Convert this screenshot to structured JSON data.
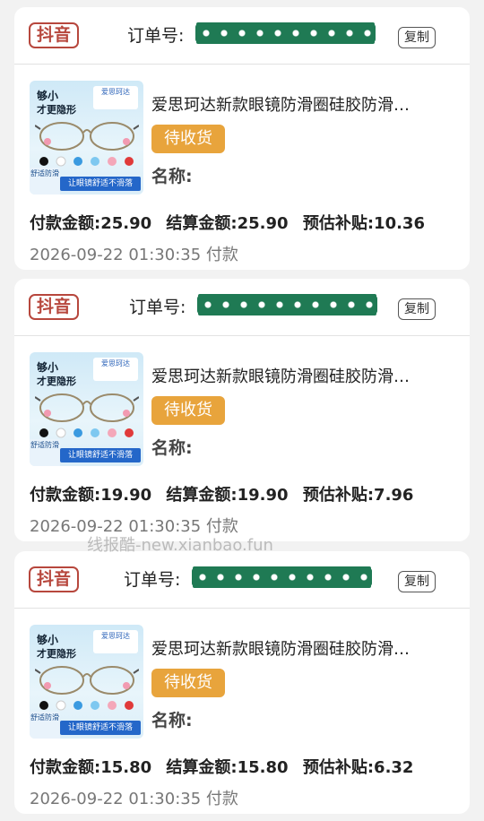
{
  "orders": [
    {
      "platform": "抖音",
      "order_label": "订单号:",
      "copy_label": "复制",
      "product_title": "爱思珂达新款眼镜防滑圈硅胶防滑…",
      "status": "待收货",
      "name_label": "名称:",
      "pay_amount": "付款金额:25.90",
      "settle_amount": "结算金额:25.90",
      "subsidy": "预估补贴:10.36",
      "paid_time": "2026-09-22 01:30:35 付款"
    },
    {
      "platform": "抖音",
      "order_label": "订单号:",
      "copy_label": "复制",
      "product_title": "爱思珂达新款眼镜防滑圈硅胶防滑…",
      "status": "待收货",
      "name_label": "名称:",
      "pay_amount": "付款金额:19.90",
      "settle_amount": "结算金额:19.90",
      "subsidy": "预估补贴:7.96",
      "paid_time": "2026-09-22 01:30:35 付款"
    },
    {
      "platform": "抖音",
      "order_label": "订单号:",
      "copy_label": "复制",
      "product_title": "爱思珂达新款眼镜防滑圈硅胶防滑…",
      "status": "待收货",
      "name_label": "名称:",
      "pay_amount": "付款金额:15.80",
      "settle_amount": "结算金额:15.80",
      "subsidy": "预估补贴:6.32",
      "paid_time": "2026-09-22 01:30:35 付款"
    }
  ],
  "thumbnail": {
    "headline_1": "够小",
    "headline_2": "才更隐形",
    "brand": "爱思珂达",
    "foot_left": "舒适防滑",
    "foot_banner": "让眼镜舒适不滑落"
  },
  "watermark": "线报酷-new.xianbao.fun",
  "colors": {
    "platform_tag": "#b7473d",
    "status_button": "#e8a43c",
    "order_mask": "#1f7a54"
  }
}
